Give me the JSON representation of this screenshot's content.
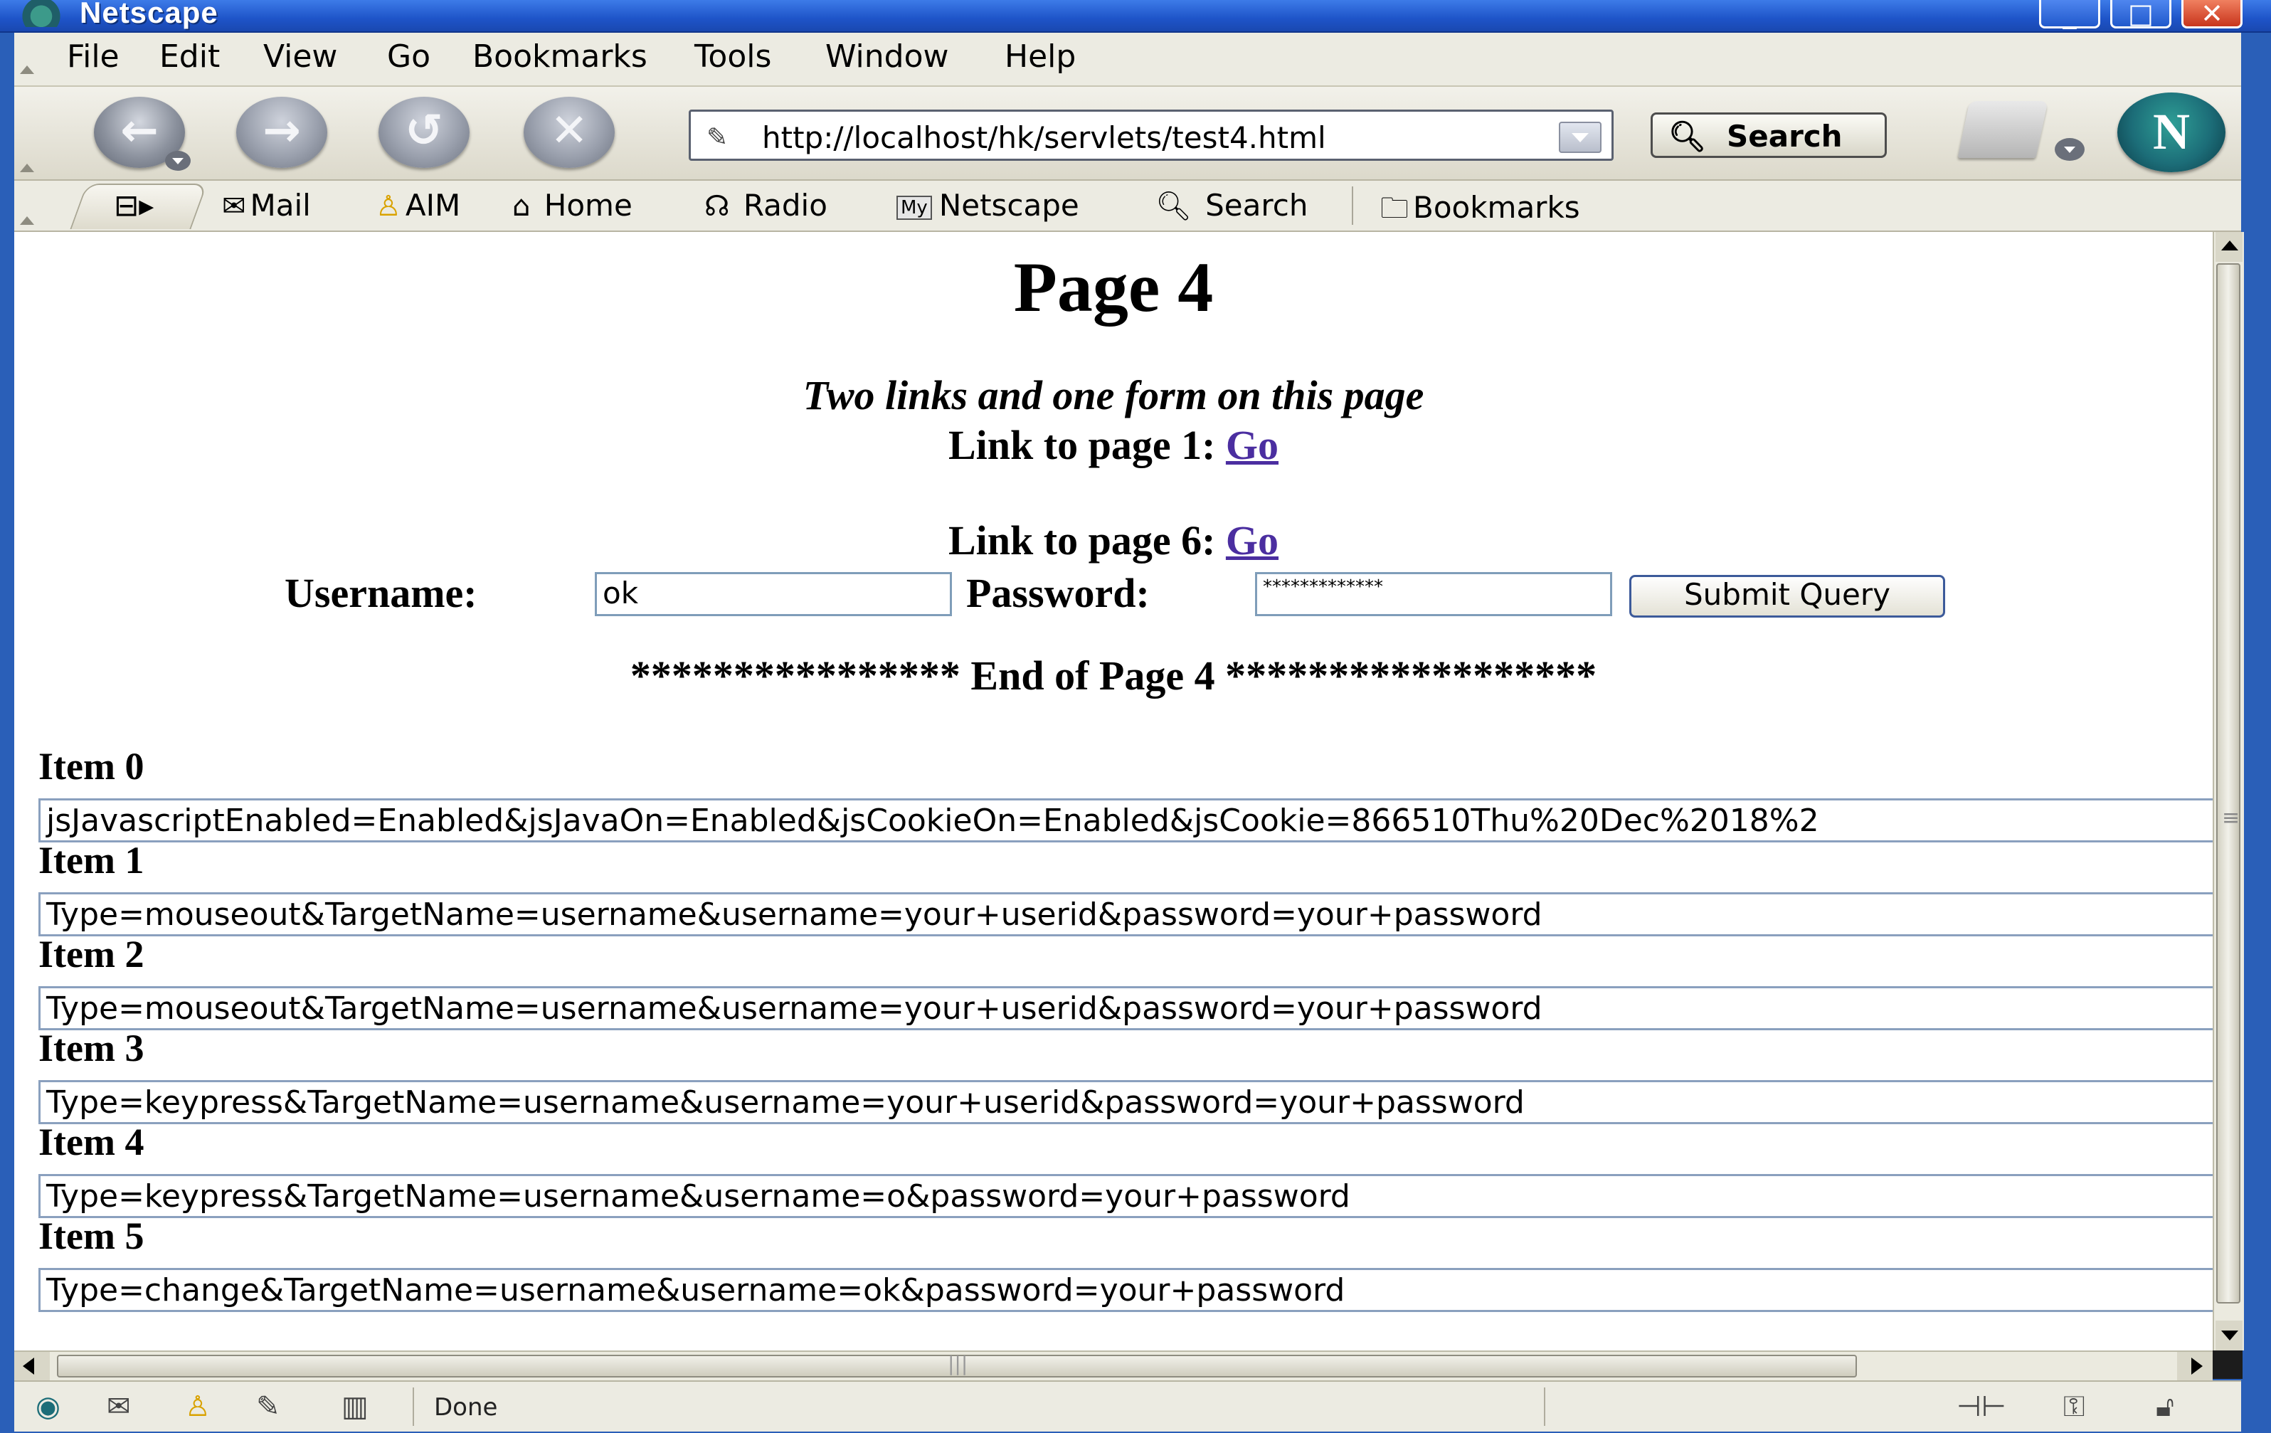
{
  "window": {
    "title": "Netscape"
  },
  "menu": [
    "File",
    "Edit",
    "View",
    "Go",
    "Bookmarks",
    "Tools",
    "Window",
    "Help"
  ],
  "navbar": {
    "url": "http://localhost/hk/servlets/test4.html",
    "search_label": "Search",
    "logo_letter": "N"
  },
  "personal_toolbar": {
    "mail": "Mail",
    "aim": "AIM",
    "home": "Home",
    "radio": "Radio",
    "my_badge": "My",
    "netscape": "Netscape",
    "search": "Search",
    "bookmarks": "Bookmarks"
  },
  "page": {
    "title": "Page 4",
    "subtitle": "Two links and one form on this page",
    "link1_text": "Link to page 1:",
    "link1_anchor": "Go",
    "link2_text": "Link to page 6:",
    "link2_anchor": "Go",
    "username_label": "Username:",
    "username_value": "ok",
    "password_label": "Password:",
    "password_value": "*************",
    "submit_label": "Submit Query",
    "end_text": "**************** End of Page 4 ******************"
  },
  "items": [
    {
      "label": "Item 0",
      "value": "jsJavascriptEnabled=Enabled&jsJavaOn=Enabled&jsCookieOn=Enabled&jsCookie=866510Thu%20Dec%2018%2"
    },
    {
      "label": "Item 1",
      "value": "Type=mouseout&TargetName=username&username=your+userid&password=your+password"
    },
    {
      "label": "Item 2",
      "value": "Type=mouseout&TargetName=username&username=your+userid&password=your+password"
    },
    {
      "label": "Item 3",
      "value": "Type=keypress&TargetName=username&username=your+userid&password=your+password"
    },
    {
      "label": "Item 4",
      "value": "Type=keypress&TargetName=username&username=o&password=your+password"
    },
    {
      "label": "Item 5",
      "value": "Type=change&TargetName=username&username=ok&password=your+password"
    }
  ],
  "status": {
    "text": "Done"
  },
  "colors": {
    "titlebar": "#1e54c8",
    "link": "#4b2ea0",
    "chrome": "#ecebe2"
  }
}
